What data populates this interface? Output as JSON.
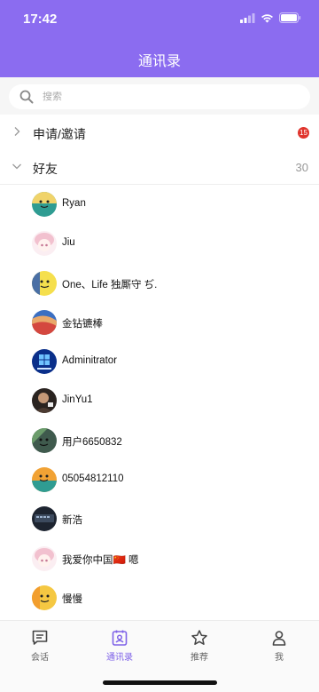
{
  "status": {
    "time": "17:42"
  },
  "header": {
    "title": "通讯录"
  },
  "search": {
    "placeholder": "搜索"
  },
  "groups": {
    "requests": {
      "label": "申请/邀请",
      "badge": "15"
    },
    "friends": {
      "label": "好友",
      "count": "30"
    }
  },
  "friends": [
    {
      "name": "Ryan",
      "avatar": "teal-smile-avatar"
    },
    {
      "name": "Jiu",
      "avatar": "anime-girl-avatar"
    },
    {
      "name": "One、Life 独厮守 ぢ.",
      "avatar": "yellow-smile-avatar"
    },
    {
      "name": "金钻镳棒",
      "avatar": "sunset-avatar"
    },
    {
      "name": "Adminitrator",
      "avatar": "windows-avatar"
    },
    {
      "name": "JinYu1",
      "avatar": "photo-man-avatar"
    },
    {
      "name": "用户6650832",
      "avatar": "green-smile-avatar"
    },
    {
      "name": "05054812110",
      "avatar": "orange-smile-avatar"
    },
    {
      "name": "新浩",
      "avatar": "keyboard-photo-avatar"
    },
    {
      "name": "我爱你中国🇨🇳 嗯",
      "avatar": "anime-girl-avatar"
    },
    {
      "name": "慢慢",
      "avatar": "yellow-smile-avatar"
    }
  ],
  "tabs": [
    {
      "label": "会话",
      "icon": "chat-icon"
    },
    {
      "label": "通讯录",
      "icon": "contacts-icon",
      "active": true
    },
    {
      "label": "推荐",
      "icon": "star-icon"
    },
    {
      "label": "我",
      "icon": "person-icon"
    }
  ],
  "colors": {
    "accent": "#8b6cf0",
    "badge": "#e0342c"
  }
}
